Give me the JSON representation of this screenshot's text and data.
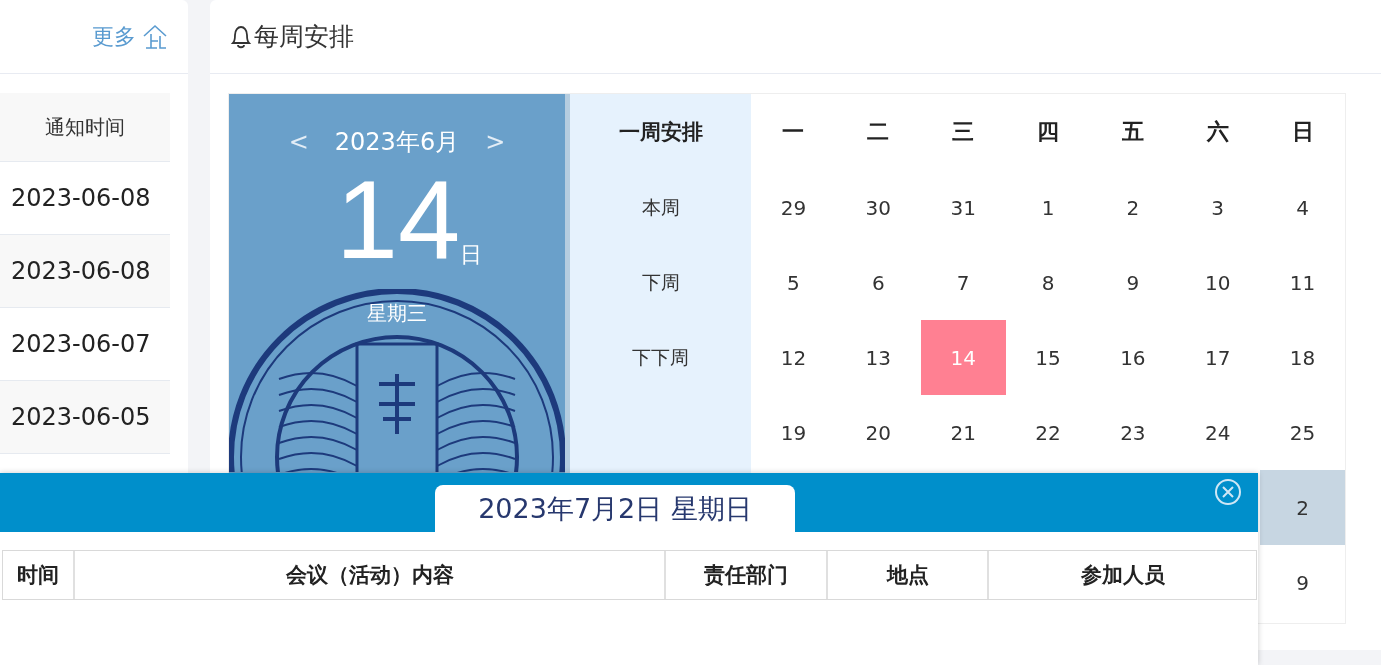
{
  "notices": {
    "more_link": "更多",
    "column": "通知时间",
    "rows": [
      "2023-06-08",
      "2023-06-08",
      "2023-06-07",
      "2023-06-05"
    ]
  },
  "weekly": {
    "title": "每周安排",
    "month_nav": {
      "prev": "<",
      "month": "2023年6月",
      "next": ">"
    },
    "today": {
      "day": "14",
      "suffix": "日",
      "weekday": "星期三"
    },
    "week_options": {
      "header": "一周安排",
      "items": [
        {
          "label": "本周",
          "selected": false
        },
        {
          "label": "下周",
          "selected": false
        },
        {
          "label": "下下周",
          "selected": false
        }
      ]
    },
    "weekdays": [
      "一",
      "二",
      "三",
      "四",
      "五",
      "六",
      "日"
    ],
    "weeks": [
      {
        "days": [
          {
            "day": "29",
            "today": false,
            "selected": false
          },
          {
            "day": "30",
            "today": false,
            "selected": false
          },
          {
            "day": "31",
            "today": false,
            "selected": false
          },
          {
            "day": "1",
            "today": false,
            "selected": false
          },
          {
            "day": "2",
            "today": false,
            "selected": false
          },
          {
            "day": "3",
            "today": false,
            "selected": false
          },
          {
            "day": "4",
            "today": false,
            "selected": false
          }
        ]
      },
      {
        "days": [
          {
            "day": "5",
            "today": false,
            "selected": false
          },
          {
            "day": "6",
            "today": false,
            "selected": false
          },
          {
            "day": "7",
            "today": false,
            "selected": false
          },
          {
            "day": "8",
            "today": false,
            "selected": false
          },
          {
            "day": "9",
            "today": false,
            "selected": false
          },
          {
            "day": "10",
            "today": false,
            "selected": false
          },
          {
            "day": "11",
            "today": false,
            "selected": false
          }
        ]
      },
      {
        "days": [
          {
            "day": "12",
            "today": false,
            "selected": false
          },
          {
            "day": "13",
            "today": false,
            "selected": false
          },
          {
            "day": "14",
            "today": true,
            "selected": false
          },
          {
            "day": "15",
            "today": false,
            "selected": false
          },
          {
            "day": "16",
            "today": false,
            "selected": false
          },
          {
            "day": "17",
            "today": false,
            "selected": false
          },
          {
            "day": "18",
            "today": false,
            "selected": false
          }
        ]
      },
      {
        "days": [
          {
            "day": "19",
            "today": false,
            "selected": false
          },
          {
            "day": "20",
            "today": false,
            "selected": false
          },
          {
            "day": "21",
            "today": false,
            "selected": false
          },
          {
            "day": "22",
            "today": false,
            "selected": false
          },
          {
            "day": "23",
            "today": false,
            "selected": false
          },
          {
            "day": "24",
            "today": false,
            "selected": false
          },
          {
            "day": "25",
            "today": false,
            "selected": false
          }
        ]
      },
      {
        "days": [
          {
            "day": "2",
            "today": false,
            "selected": true
          }
        ]
      },
      {
        "days": [
          {
            "day": "9",
            "today": false,
            "selected": false
          }
        ]
      }
    ]
  },
  "popup": {
    "title": "2023年7月2日 星期日",
    "columns": [
      "时间",
      "会议（活动）内容",
      "责任部门",
      "地点",
      "参加人员"
    ]
  }
}
